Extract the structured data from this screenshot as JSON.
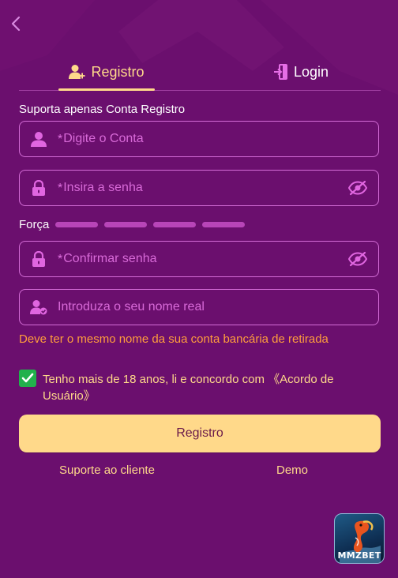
{
  "header": {
    "back_icon": "chevron-left-icon"
  },
  "tabs": [
    {
      "label": "Registro",
      "icon": "add-user-icon",
      "active": true
    },
    {
      "label": "Login",
      "icon": "login-door-icon",
      "active": false
    }
  ],
  "form": {
    "caption": "Suporta apenas Conta Registro",
    "account": {
      "required_mark": "*",
      "placeholder": "Digite o Conta",
      "icon": "user-icon"
    },
    "password": {
      "required_mark": "*",
      "placeholder": "Insira a senha",
      "icon": "lock-icon",
      "toggle_icon": "eye-off-icon"
    },
    "strength": {
      "label": "Força",
      "segments": 4,
      "filled": 0
    },
    "confirm": {
      "required_mark": "*",
      "placeholder": "Confirmar senha",
      "icon": "lock-icon",
      "toggle_icon": "eye-off-icon"
    },
    "realname": {
      "placeholder": "Introduza o seu nome real",
      "icon": "verified-user-icon"
    },
    "warning": "Deve ter o mesmo nome da sua conta bancária de retirada",
    "agreement": {
      "checked": true,
      "text": "Tenho mais de 18 anos, li e concordo com ",
      "link": "《Acordo de Usuário》"
    },
    "submit_label": "Registro"
  },
  "footer": {
    "support": "Suporte ao cliente",
    "demo": "Demo"
  },
  "app_badge": {
    "label": "MMZBET"
  },
  "colors": {
    "background": "#6b0f6e",
    "accent": "#ffd98a",
    "field_border": "#d36cd6",
    "placeholder": "#d86ad8",
    "warning": "#ff9d3c",
    "checkbox": "#22b14c"
  }
}
